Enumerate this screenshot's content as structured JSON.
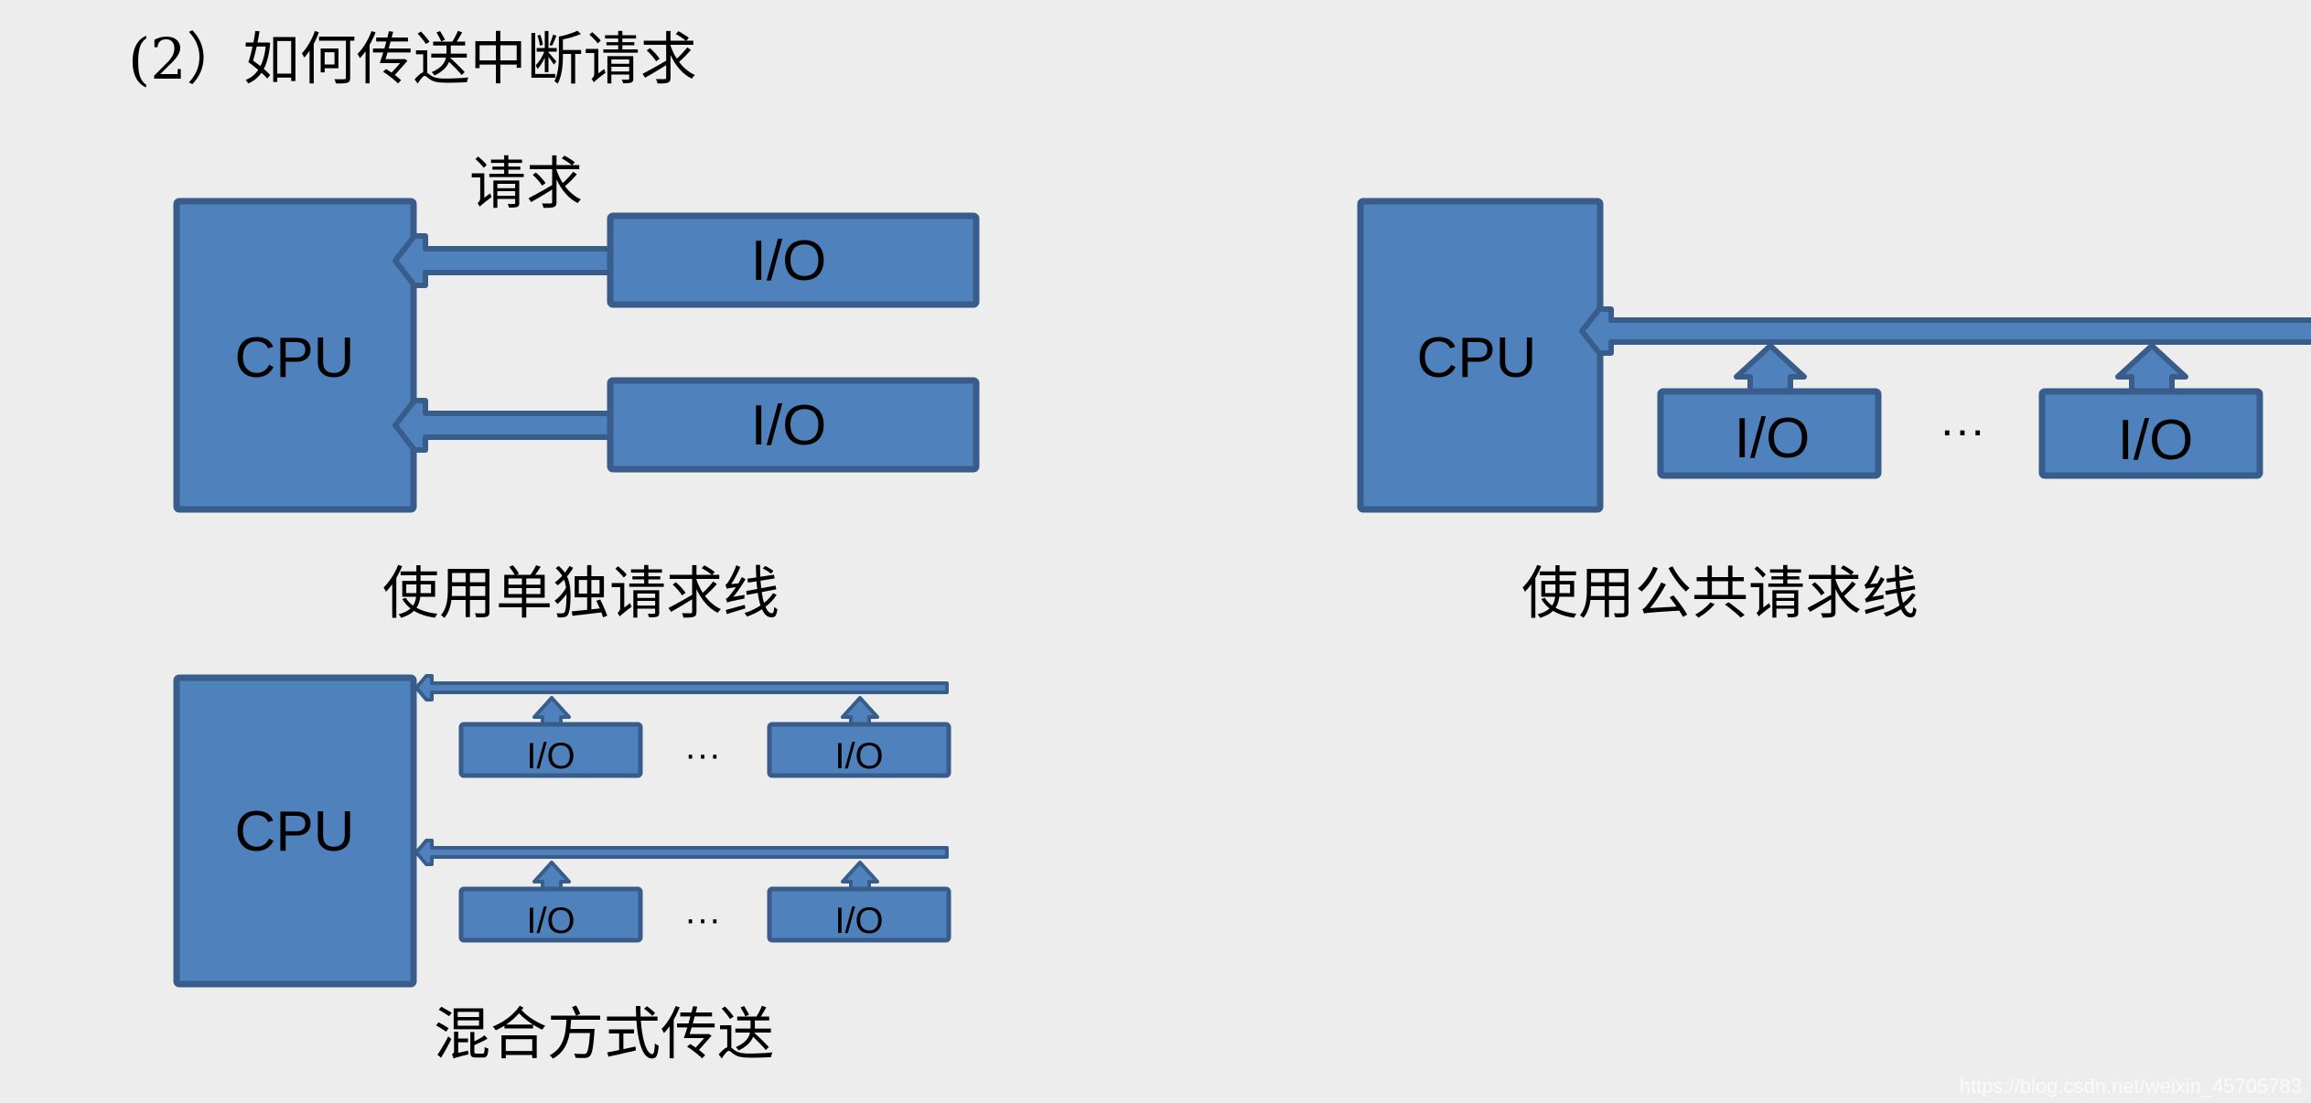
{
  "title": "(2）如何传送中断请求",
  "colors": {
    "background": "#ededed",
    "box_fill": "#4f81bd",
    "box_stroke": "#385d8a",
    "text": "#000000"
  },
  "diagram_separate": {
    "cpu_label": "CPU",
    "request_label": "请求",
    "io_labels": [
      "I/O",
      "I/O"
    ],
    "caption": "使用单独请求线"
  },
  "diagram_shared": {
    "cpu_label": "CPU",
    "io_labels": [
      "I/O",
      "I/O"
    ],
    "ellipsis": "···",
    "caption": "使用公共请求线"
  },
  "diagram_mixed": {
    "cpu_label": "CPU",
    "rows": [
      {
        "io_labels": [
          "I/O",
          "I/O"
        ],
        "ellipsis": "···"
      },
      {
        "io_labels": [
          "I/O",
          "I/O"
        ],
        "ellipsis": "···"
      }
    ],
    "caption": "混合方式传送"
  },
  "watermark": "https://blog.csdn.net/weixin_45705783"
}
